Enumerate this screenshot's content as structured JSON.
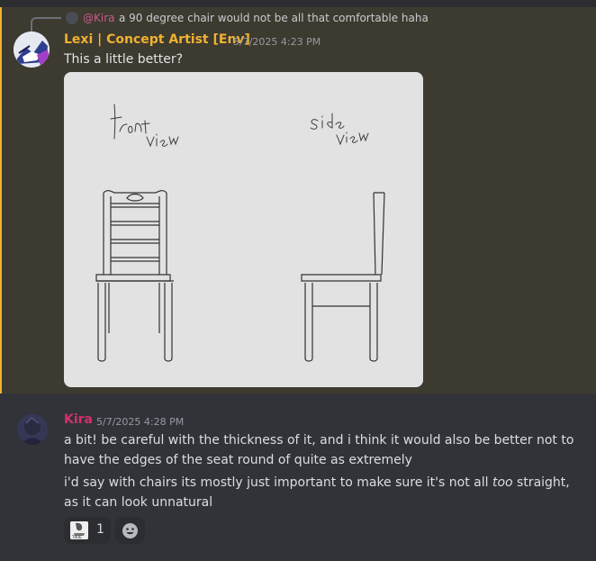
{
  "reply": {
    "mention": "@Kira",
    "text": "a 90 degree chair would not be all that comfortable haha"
  },
  "message1": {
    "author": "Lexi | Concept Artist [Env]",
    "timestamp": "5/7/2025 4:23 PM",
    "text": "This a little better?",
    "attachment": {
      "sketch_labels": [
        "front view",
        "side view"
      ]
    }
  },
  "message2": {
    "author": "Kira",
    "timestamp": "5/7/2025 4:28 PM",
    "line1": "a bit! be careful with the thickness of it, and i think it would also be better not to have the edges of the seat round of quite as extremely",
    "line2_before": "i'd say with chairs its mostly just important to make sure it's not all ",
    "line2_em": "too",
    "line2_after": " straight, as it can look unnatural"
  },
  "reactions": [
    {
      "emoji": "true-meme-icon",
      "label": "TRUE",
      "count": "1"
    }
  ],
  "colors": {
    "background": "#313338",
    "highlight": "#3d3a2f",
    "highlight_bar": "#f0b232",
    "lexi_name": "#f0b232",
    "kira_name": "#d4306b"
  }
}
